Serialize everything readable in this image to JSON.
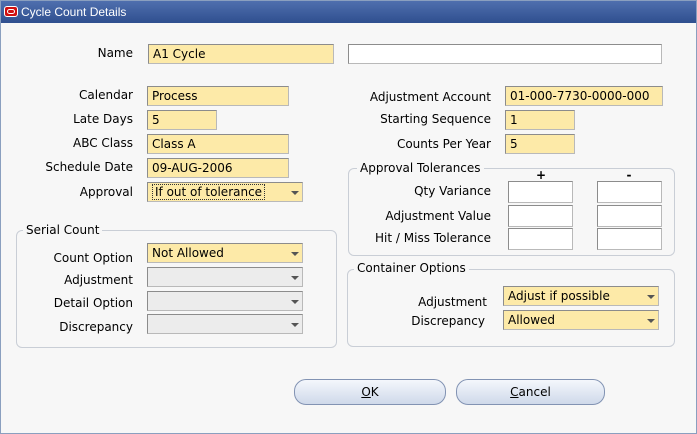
{
  "window": {
    "title": "Cycle Count Details",
    "icon": "oracle-app-icon"
  },
  "form": {
    "name_label": "Name",
    "name_value": "A1 Cycle",
    "description_value": "",
    "calendar_label": "Calendar",
    "calendar_value": "Process",
    "late_days_label": "Late Days",
    "late_days_value": "5",
    "abc_class_label": "ABC Class",
    "abc_class_value": "Class A",
    "schedule_date_label": "Schedule Date",
    "schedule_date_value": "09-AUG-2006",
    "approval_label": "Approval",
    "approval_value": "If out of tolerance",
    "adjustment_account_label": "Adjustment Account",
    "adjustment_account_value": "01-000-7730-0000-000",
    "starting_sequence_label": "Starting Sequence",
    "starting_sequence_value": "1",
    "counts_per_year_label": "Counts Per Year",
    "counts_per_year_value": "5"
  },
  "approval_tolerances": {
    "title": "Approval Tolerances",
    "plus_header": "+",
    "minus_header": "-",
    "rows": [
      {
        "label": "Qty Variance",
        "plus": "",
        "minus": ""
      },
      {
        "label": "Adjustment Value",
        "plus": "",
        "minus": ""
      },
      {
        "label": "Hit / Miss Tolerance",
        "plus": "",
        "minus": ""
      }
    ]
  },
  "serial_count": {
    "title": "Serial Count",
    "count_option_label": "Count Option",
    "count_option_value": "Not Allowed",
    "adjustment_label": "Adjustment",
    "adjustment_value": "",
    "detail_option_label": "Detail Option",
    "detail_option_value": "",
    "discrepancy_label": "Discrepancy",
    "discrepancy_value": ""
  },
  "container_options": {
    "title": "Container Options",
    "adjustment_label": "Adjustment",
    "adjustment_value": "Adjust if possible",
    "discrepancy_label": "Discrepancy",
    "discrepancy_value": "Allowed"
  },
  "buttons": {
    "ok_accel": "O",
    "ok_rest": "K",
    "cancel_accel": "C",
    "cancel_rest": "ancel"
  },
  "colors": {
    "required_field": "#fdeaa8",
    "titlebar": "#3b5998",
    "disabled_field": "#ececec"
  }
}
